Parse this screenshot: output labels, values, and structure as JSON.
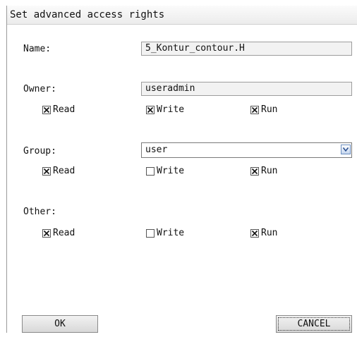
{
  "title": "Set advanced access rights",
  "name": {
    "label": "Name:",
    "value": "5_Kontur_contour.H"
  },
  "owner": {
    "label": "Owner:",
    "value": "useradmin",
    "read": {
      "label": "Read",
      "checked": true
    },
    "write": {
      "label": "Write",
      "checked": true
    },
    "run": {
      "label": "Run",
      "checked": true
    }
  },
  "group": {
    "label": "Group:",
    "value": "user",
    "read": {
      "label": "Read",
      "checked": true
    },
    "write": {
      "label": "Write",
      "checked": false
    },
    "run": {
      "label": "Run",
      "checked": true
    }
  },
  "other": {
    "label": "Other:",
    "read": {
      "label": "Read",
      "checked": true
    },
    "write": {
      "label": "Write",
      "checked": false
    },
    "run": {
      "label": "Run",
      "checked": true
    }
  },
  "buttons": {
    "ok": "OK",
    "cancel": "CANCEL"
  },
  "colors": {
    "select_arrow_border": "#6c8ebf",
    "dialog_border": "#9a9a9a"
  },
  "icons": {
    "checkbox_mark": "x-mark-icon",
    "dropdown": "chevron-down-icon"
  }
}
